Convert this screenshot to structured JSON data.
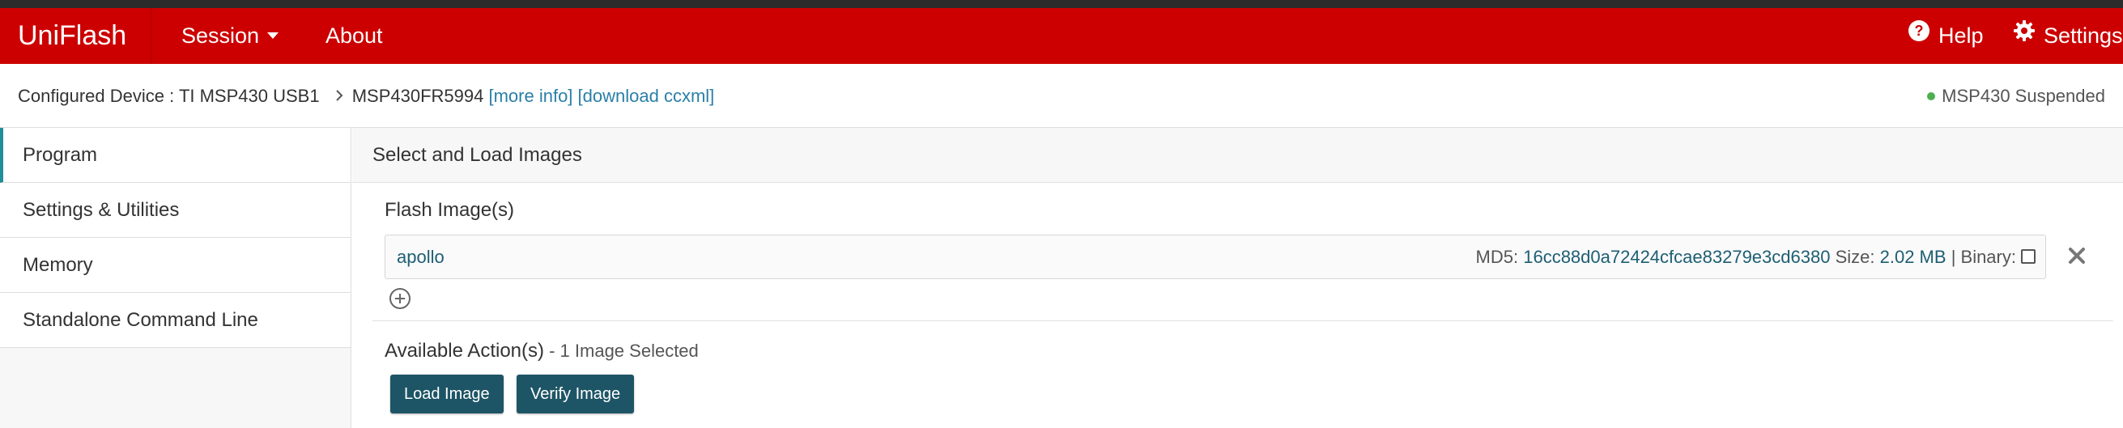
{
  "header": {
    "brand": "UniFlash",
    "nav": {
      "session_label": "Session",
      "about_label": "About",
      "help_label": "Help",
      "settings_label": "Settings"
    }
  },
  "device_bar": {
    "label": "Configured Device",
    "separator": " : ",
    "connection": "TI MSP430 USB1",
    "device": "MSP430FR5994",
    "more_info_link": "[more info]",
    "download_link": "[download ccxml]",
    "status": "MSP430 Suspended",
    "status_color": "#4caf50"
  },
  "sidebar": {
    "items": [
      {
        "label": "Program",
        "active": true
      },
      {
        "label": "Settings & Utilities",
        "active": false
      },
      {
        "label": "Memory",
        "active": false
      },
      {
        "label": "Standalone Command Line",
        "active": false
      }
    ]
  },
  "main": {
    "section_title": "Select and Load Images",
    "flash_title": "Flash Image(s)",
    "image": {
      "name": "apollo",
      "md5_label": "MD5:",
      "md5": "16cc88d0a72424cfcae83279e3cd6380",
      "size_label": "Size:",
      "size": "2.02 MB",
      "binary_label": "| Binary:",
      "binary_checked": false
    },
    "actions_title": "Available Action(s)",
    "actions_subtitle": " - 1 Image Selected",
    "buttons": {
      "load_label": "Load Image",
      "verify_label": "Verify Image"
    }
  },
  "colors": {
    "header_red": "#cc0000",
    "button_teal": "#1d5566",
    "link_blue": "#2a7fa8",
    "active_accent": "#1f8f9a"
  },
  "icons": {
    "help": "question-circle-icon",
    "settings": "gear-icon",
    "remove": "close-icon",
    "add": "plus-circle-icon",
    "session_dropdown": "caret-down-icon"
  }
}
